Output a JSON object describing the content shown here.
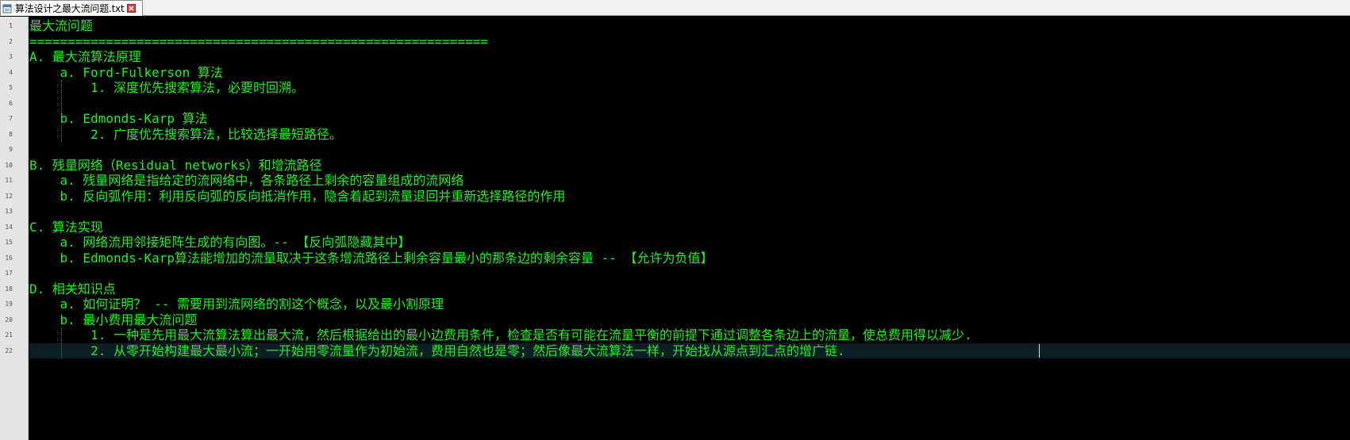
{
  "tab": {
    "title": "算法设计之最大流问题.txt",
    "icon": "text-file-icon",
    "close_icon": "close-icon"
  },
  "colors": {
    "text": "#22ee22",
    "background": "#000000",
    "current_line": "#0d1f25",
    "gutter": "#e4e4e4"
  },
  "editor": {
    "lines": [
      {
        "no": "1",
        "text": "最大流问题"
      },
      {
        "no": "2",
        "text": "============================================================"
      },
      {
        "no": "3",
        "text": "A. 最大流算法原理"
      },
      {
        "no": "4",
        "text": "    a. Ford-Fulkerson 算法"
      },
      {
        "no": "5",
        "text": "        1. 深度优先搜索算法，必要时回溯。"
      },
      {
        "no": "6",
        "text": ""
      },
      {
        "no": "7",
        "text": "    b. Edmonds-Karp 算法"
      },
      {
        "no": "8",
        "text": "        2. 广度优先搜索算法，比较选择最短路径。"
      },
      {
        "no": "9",
        "text": ""
      },
      {
        "no": "10",
        "text": "B. 残量网络（Residual networks）和增流路径"
      },
      {
        "no": "11",
        "text": "    a. 残量网络是指给定的流网络中，各条路径上剩余的容量组成的流网络"
      },
      {
        "no": "12",
        "text": "    b. 反向弧作用：利用反向弧的反向抵消作用，隐含着起到流量退回并重新选择路径的作用"
      },
      {
        "no": "13",
        "text": ""
      },
      {
        "no": "14",
        "text": "C. 算法实现"
      },
      {
        "no": "15",
        "text": "    a. 网络流用邻接矩阵生成的有向图。-- 【反向弧隐藏其中】"
      },
      {
        "no": "16",
        "text": "    b. Edmonds-Karp算法能增加的流量取决于这条增流路径上剩余容量最小的那条边的剩余容量 -- 【允许为负值】"
      },
      {
        "no": "17",
        "text": ""
      },
      {
        "no": "18",
        "text": "D. 相关知识点"
      },
      {
        "no": "19",
        "text": "    a. 如何证明？ -- 需要用到流网络的割这个概念，以及最小割原理"
      },
      {
        "no": "20",
        "text": "    b. 最小费用最大流问题"
      },
      {
        "no": "21",
        "text": "        1. 一种是先用最大流算法算出最大流，然后根据给出的最小边费用条件，检查是否有可能在流量平衡的前提下通过调整各条边上的流量，使总费用得以减少."
      },
      {
        "no": "22",
        "text": "        2. 从零开始构建最大最小流；一开始用零流量作为初始流，费用自然也是零；然后像最大流算法一样，开始找从源点到汇点的增广链."
      }
    ]
  }
}
